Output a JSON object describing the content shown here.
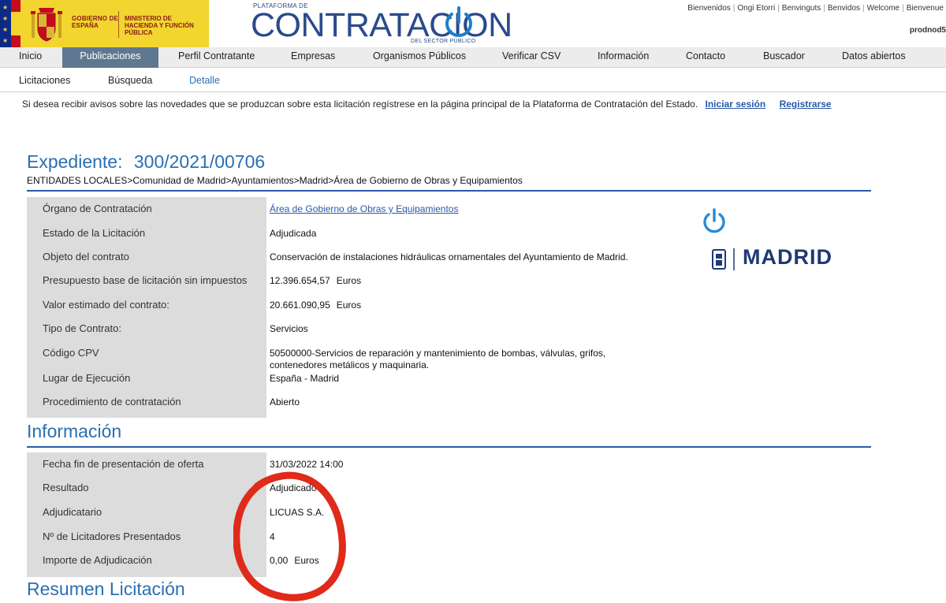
{
  "header": {
    "gov_name": "GOBIERNO DE ESPAÑA",
    "ministry_name": "MINISTERIO DE HACIENDA Y FUNCIÓN PÚBLICA",
    "platform_small": "PLATAFORMA DE",
    "platform_title": "CONTRATACION",
    "platform_sub": "DEL SECTOR PÚBLICO",
    "languages": [
      "Bienvenidos",
      "Ongi Etorri",
      "Benvinguts",
      "Benvidos",
      "Welcome",
      "Bienvenue"
    ],
    "server_id": "prodnod5"
  },
  "main_nav": {
    "items": [
      {
        "label": "Inicio"
      },
      {
        "label": "Publicaciones"
      },
      {
        "label": "Perfil Contratante"
      },
      {
        "label": "Empresas"
      },
      {
        "label": "Organismos Públicos"
      },
      {
        "label": "Verificar CSV"
      },
      {
        "label": "Información"
      },
      {
        "label": "Contacto"
      },
      {
        "label": "Buscador"
      },
      {
        "label": "Datos abiertos"
      }
    ],
    "active": "Publicaciones"
  },
  "sub_nav": {
    "items": [
      {
        "label": "Licitaciones"
      },
      {
        "label": "Búsqueda"
      },
      {
        "label": "Detalle"
      }
    ],
    "active": "Detalle"
  },
  "notice": {
    "text": "Si desea recibir avisos sobre las novedades que se produzcan sobre esta licitación regístrese en la página principal de la Plataforma de Contratación del Estado.",
    "login_link": "Iniciar sesión",
    "register_link": "Registrarse"
  },
  "expediente": {
    "title_label": "Expediente:",
    "number": "300/2021/00706",
    "breadcrumb": "ENTIDADES LOCALES>Comunidad de Madrid>Ayuntamientos>Madrid>Área de Gobierno de Obras y Equipamientos",
    "rows": [
      {
        "label": "Órgano de Contratación",
        "value": "Área de Gobierno de Obras y Equipamientos"
      },
      {
        "label": "Estado de la Licitación",
        "value": "Adjudicada"
      },
      {
        "label": "Objeto del contrato",
        "value": "Conservación de instalaciones hidráulicas ornamentales del Ayuntamiento de Madrid."
      },
      {
        "label": "Presupuesto base de licitación sin impuestos",
        "value": "12.396.654,57",
        "unit": "Euros"
      },
      {
        "label": "Valor estimado del contrato:",
        "value": "20.661.090,95",
        "unit": "Euros"
      },
      {
        "label": "Tipo de Contrato:",
        "value": "Servicios"
      },
      {
        "label": "Código CPV",
        "value": "50500000-Servicios de reparación y mantenimiento de bombas, válvulas, grifos, contenedores metálicos y maquinaria."
      },
      {
        "label": "Lugar de Ejecución",
        "value": "España - Madrid"
      },
      {
        "label": "Procedimiento de contratación",
        "value": "Abierto"
      }
    ],
    "logo_text": "MADRID"
  },
  "informacion": {
    "title": "Información",
    "rows": [
      {
        "label": "Fecha fin de presentación de oferta",
        "value": "31/03/2022 14:00"
      },
      {
        "label": "Resultado",
        "value": "Adjudicado"
      },
      {
        "label": "Adjudicatario",
        "value": "LICUAS S.A."
      },
      {
        "label": "Nº de Licitadores Presentados",
        "value": "4"
      },
      {
        "label": "Importe de Adjudicación",
        "value": "0,00",
        "unit": "Euros"
      }
    ]
  },
  "resumen": {
    "title": "Resumen Licitación"
  },
  "colors": {
    "gov_yellow": "#f2d52e",
    "brand_blue": "#2a4a8c",
    "heading_blue": "#2a6fb3",
    "link_blue": "#2a5aa8",
    "nav_active": "#5f7890",
    "label_panel": "#dcdcdc",
    "annotation_red": "#e02a1a"
  }
}
